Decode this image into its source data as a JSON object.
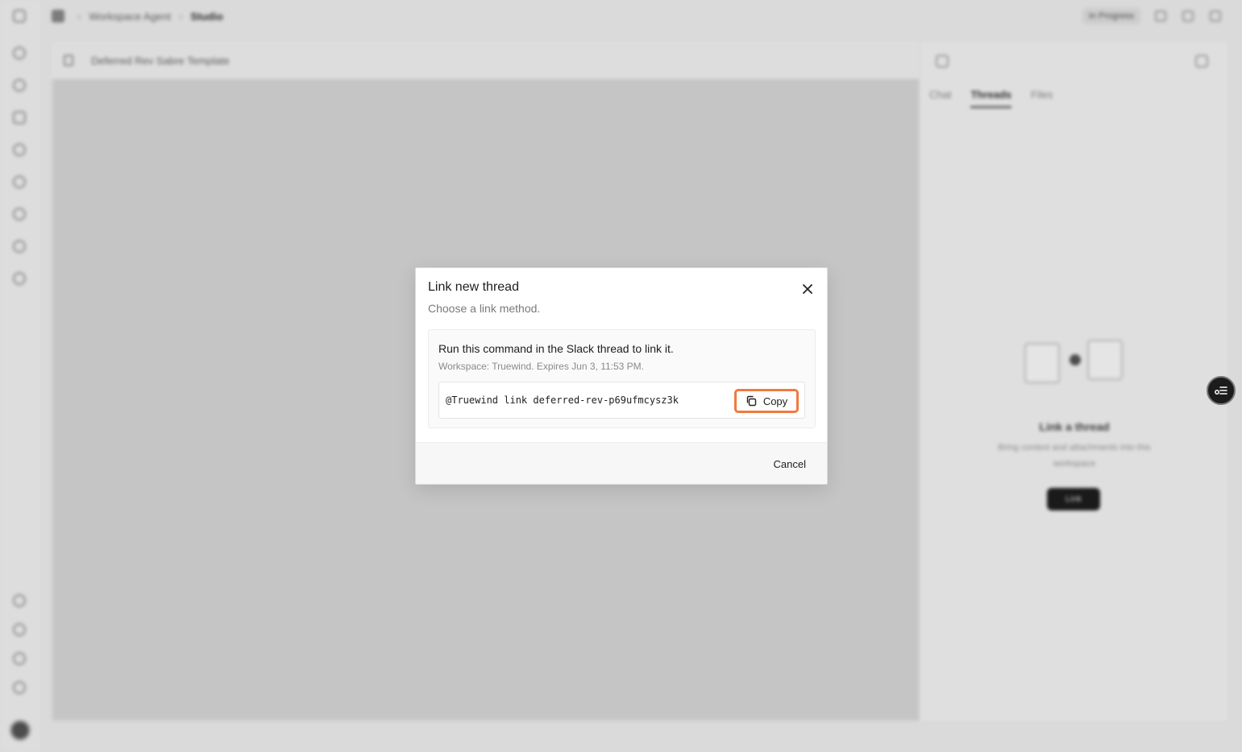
{
  "background": {
    "breadcrumb": [
      "Workspace Agent",
      "Studio"
    ],
    "top_badge": "In Progress",
    "document_title": "Deferred Rev Sabre Template",
    "panel_tabs": [
      "Chat",
      "Threads",
      "Files"
    ],
    "active_tab": "Threads",
    "empty_state": {
      "title": "Link a thread",
      "subtitle": "Bring context and attachments into this workspace",
      "button_label": "Link"
    }
  },
  "modal": {
    "title": "Link new thread",
    "subtitle": "Choose a link method.",
    "method": {
      "title": "Run this command in the Slack thread to link it.",
      "meta": "Workspace: Truewind. Expires Jun 3, 11:53 PM.",
      "command": "@Truewind link deferred-rev-p69ufmcysz3k",
      "copy_label": "Copy"
    },
    "cancel_label": "Cancel"
  },
  "colors": {
    "highlight": "#f07a3e",
    "fab": "#1c1c1c"
  },
  "icons": {
    "close": "close-icon",
    "copy": "copy-icon",
    "fab": "thread-list-icon"
  }
}
